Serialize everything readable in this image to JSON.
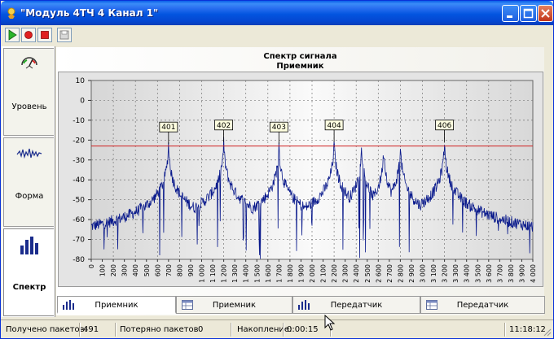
{
  "window": {
    "title": "\"Модуль 4ТЧ 4 Канал 1\""
  },
  "toolbar": {
    "play": "play-icon",
    "record": "record-icon",
    "stop": "stop-icon",
    "save": "save-icon"
  },
  "sidebar": {
    "items": [
      {
        "label": "Уровень",
        "icon": "gauge-icon"
      },
      {
        "label": "Форма",
        "icon": "waveform-icon"
      },
      {
        "label": "Спектр",
        "icon": "spectrum-icon",
        "active": true
      }
    ]
  },
  "chart": {
    "title": "Спектр сигнала",
    "subtitle": "Приемник"
  },
  "chart_data": {
    "type": "line",
    "title": "Спектр сигнала",
    "subtitle": "Приемник",
    "xlim": [
      0,
      4000
    ],
    "ylim": [
      -80,
      10
    ],
    "x_ticks": [
      "0",
      "100",
      "200",
      "300",
      "400",
      "500",
      "600",
      "700",
      "800",
      "900",
      "1 000",
      "1 100",
      "1 200",
      "1 300",
      "1 400",
      "1 500",
      "1 600",
      "1 700",
      "1 800",
      "1 900",
      "2 000",
      "2 100",
      "2 200",
      "2 300",
      "2 400",
      "2 500",
      "2 600",
      "2 700",
      "2 800",
      "2 900",
      "3 000",
      "3 100",
      "3 200",
      "3 300",
      "3 400",
      "3 500",
      "3 600",
      "3 700",
      "3 800",
      "3 900",
      "4 000"
    ],
    "y_ticks": [
      "10",
      "0",
      "-10",
      "-20",
      "-30",
      "-40",
      "-50",
      "-60",
      "-70",
      "-80"
    ],
    "threshold": -23,
    "markers": [
      {
        "label": "401",
        "x": 700,
        "y": -22
      },
      {
        "label": "402",
        "x": 1200,
        "y": -21
      },
      {
        "label": "403",
        "x": 1700,
        "y": -22
      },
      {
        "label": "404",
        "x": 2200,
        "y": -21
      },
      {
        "label": "406",
        "x": 3200,
        "y": -21
      }
    ],
    "peaks": [
      [
        700,
        -22
      ],
      [
        1200,
        -21
      ],
      [
        1700,
        -22
      ],
      [
        2200,
        -21
      ],
      [
        2450,
        -23
      ],
      [
        2650,
        -24
      ],
      [
        2800,
        -23
      ],
      [
        3200,
        -21
      ]
    ],
    "grid": true
  },
  "tabs": [
    {
      "label": "Приемник",
      "icon": "spectrum-icon",
      "active": true
    },
    {
      "label": "Приемник",
      "icon": "table-icon"
    },
    {
      "label": "Передатчик",
      "icon": "spectrum-icon"
    },
    {
      "label": "Передатчик",
      "icon": "table-icon"
    }
  ],
  "status": {
    "received_label": "Получено пакетов:",
    "received_value": "491",
    "lost_label": "Потеряно пакетов",
    "lost_value": "0",
    "accum_label": "Накопление:",
    "accum_value": "0:00:15",
    "time": "11:18:12"
  }
}
